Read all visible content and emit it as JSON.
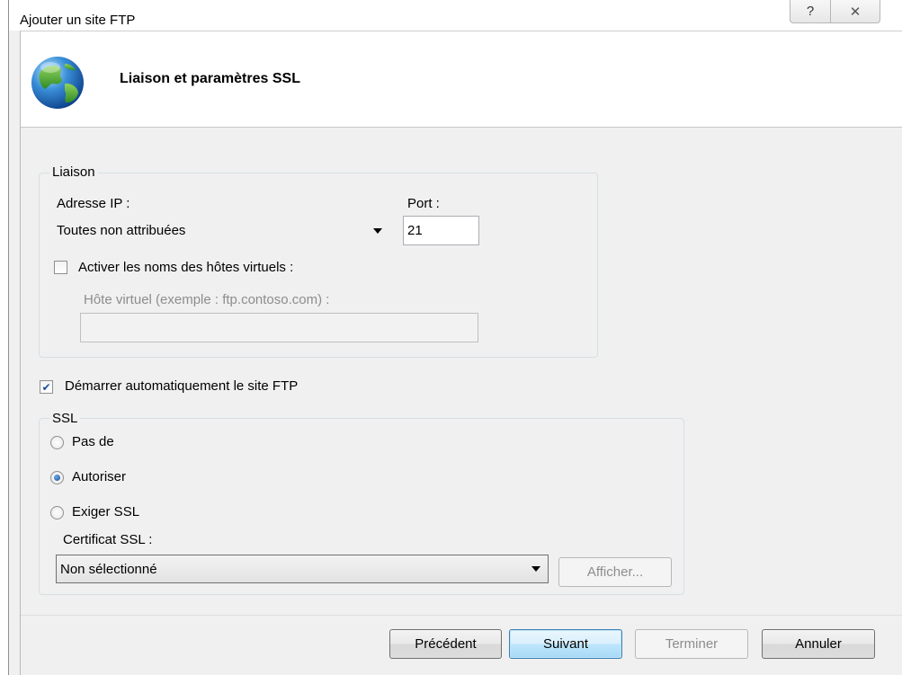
{
  "window": {
    "title": "Ajouter un site FTP",
    "help_glyph": "?",
    "close_glyph": "✕"
  },
  "header": {
    "title": "Liaison et paramètres SSL",
    "icon": "globe-icon"
  },
  "binding": {
    "legend": "Liaison",
    "ip_label": "Adresse IP :",
    "ip_value": "Toutes non attribuées",
    "port_label": "Port :",
    "port_value": "21",
    "virtual_host_checkbox_label": "Activer les noms des hôtes virtuels :",
    "virtual_host_checked": false,
    "virtual_host_label": "Hôte virtuel (exemple : ftp.contoso.com) :",
    "virtual_host_value": ""
  },
  "autostart": {
    "label": "Démarrer automatiquement le site FTP",
    "checked": true,
    "check_glyph": "✔"
  },
  "ssl": {
    "legend": "SSL",
    "options": [
      {
        "label": "Pas de",
        "selected": false
      },
      {
        "label": "Autoriser",
        "selected": true
      },
      {
        "label": "Exiger SSL",
        "selected": false
      }
    ],
    "cert_label": "Certificat SSL :",
    "cert_value": "Non sélectionné",
    "view_button": "Afficher..."
  },
  "footer": {
    "previous": "Précédent",
    "next": "Suivant",
    "finish": "Terminer",
    "cancel": "Annuler"
  },
  "colors": {
    "dialog_bg": "#f0f0f0",
    "banner_bg": "#ffffff",
    "default_button_border": "#3c7fb1",
    "disabled_text": "#8d8d8d"
  }
}
